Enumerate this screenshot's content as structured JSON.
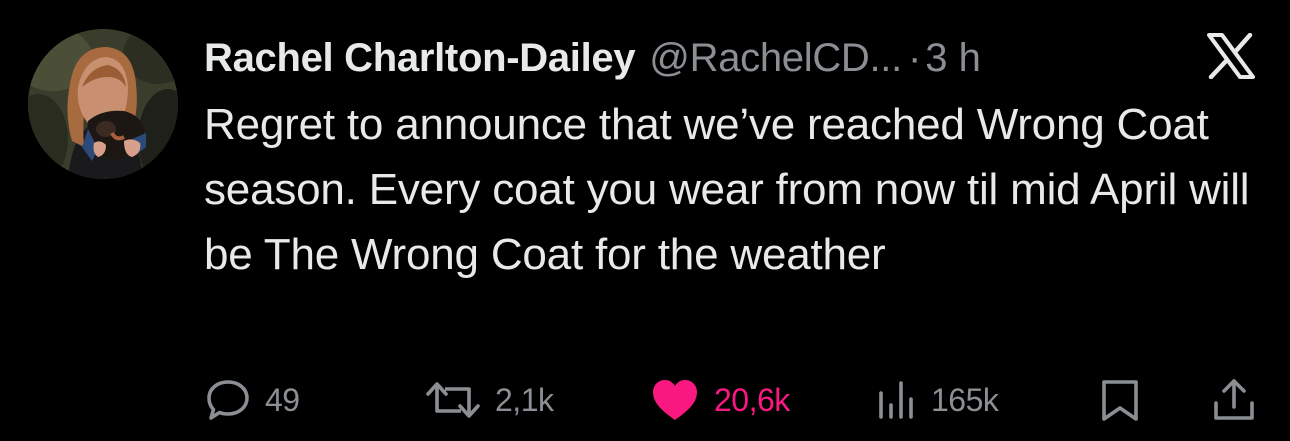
{
  "tweet": {
    "author_name": "Rachel Charlton-Dailey",
    "author_handle": "@RachelCD...",
    "separator": "·",
    "timestamp": "3 h",
    "text": "Regret to announce that we’ve reached Wrong Coat season. Every coat you wear from now til mid April will be The Wrong Coat for the weather"
  },
  "actions": {
    "replies": "49",
    "reposts": "2,1k",
    "likes": "20,6k",
    "views": "165k"
  },
  "icons": {
    "platform_logo": "x-logo-icon",
    "reply": "speech-bubble-icon",
    "repost": "repost-arrows-icon",
    "like": "heart-icon",
    "views": "bar-chart-icon",
    "bookmark": "bookmark-icon",
    "share": "share-upload-icon"
  },
  "colors": {
    "background": "#000000",
    "text_primary": "#e7e9ea",
    "text_secondary": "#8b8f94",
    "like_active": "#f91880"
  },
  "state": {
    "liked": true
  }
}
